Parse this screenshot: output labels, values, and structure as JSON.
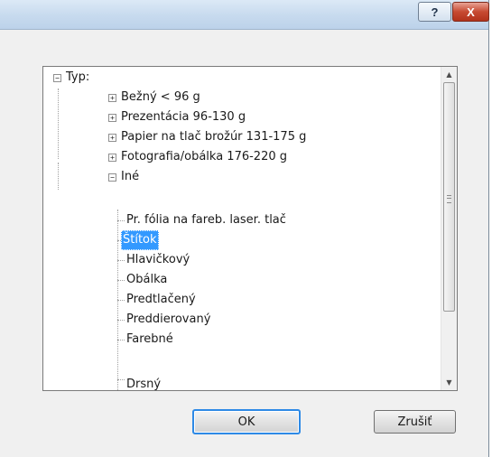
{
  "titlebar": {
    "help_label": "?",
    "close_label": "X"
  },
  "tree": {
    "root": {
      "label": "Typ:",
      "expander": "minus"
    },
    "items": [
      {
        "label": "Bežný < 96 g",
        "expander": "plus"
      },
      {
        "label": "Prezentácia 96-130 g",
        "expander": "plus"
      },
      {
        "label": "Papier na tlač brožúr 131-175 g",
        "expander": "plus"
      },
      {
        "label": "Fotografia/obálka 176-220 g",
        "expander": "plus"
      },
      {
        "label": "Iné",
        "expander": "minus"
      }
    ],
    "children": [
      {
        "label": "Pr. fólia na fareb. laser. tlač"
      },
      {
        "label": "Štítok",
        "selected": true
      },
      {
        "label": "Hlavičkový"
      },
      {
        "label": "Obálka"
      },
      {
        "label": "Predtlačený"
      },
      {
        "label": "Preddierovaný"
      },
      {
        "label": "Farebné"
      },
      {
        "label": "Drsný"
      }
    ]
  },
  "scrollbar": {
    "up_icon": "arrow-up-icon",
    "down_icon": "arrow-down-icon"
  },
  "buttons": {
    "ok": "OK",
    "cancel": "Zrušiť"
  },
  "colors": {
    "selection": "#3399ff",
    "default_button_border": "#2e8ae6",
    "close_button": "#c74a32"
  }
}
